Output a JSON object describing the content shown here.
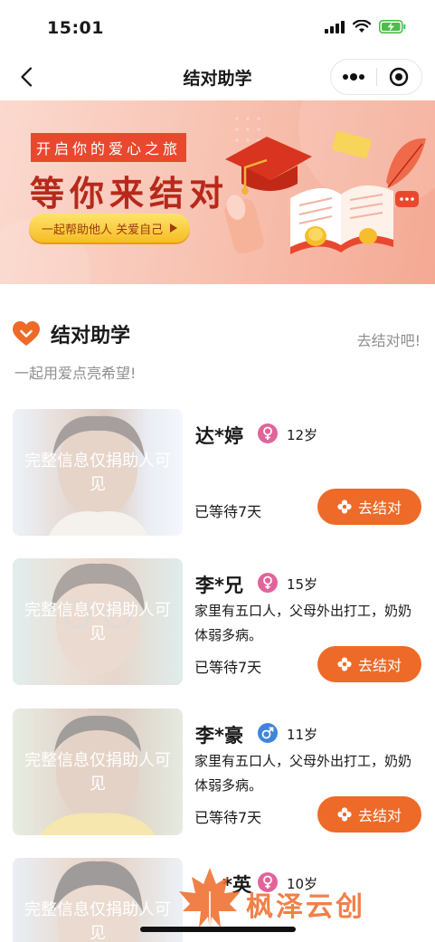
{
  "status_bar": {
    "time": "15:01"
  },
  "nav": {
    "title": "结对助学"
  },
  "banner": {
    "tag": "开启你的爱心之旅",
    "headline": "等你来结对",
    "cta": "一起帮助他人 关爱自己"
  },
  "section": {
    "title": "结对助学",
    "link": "去结对吧!",
    "subtitle": "一起用爱点亮希望!"
  },
  "mask_text": "完整信息仅捐助人可见",
  "pair_label": "去结对",
  "students": [
    {
      "name": "达*婷",
      "gender": "female",
      "age": "12岁",
      "desc": "",
      "wait": "已等待7天"
    },
    {
      "name": "李*兄",
      "gender": "female",
      "age": "15岁",
      "desc": "家里有五口人，父母外出打工，奶奶体弱多病。",
      "wait": "已等待7天"
    },
    {
      "name": "李*豪",
      "gender": "male",
      "age": "11岁",
      "desc": "家里有五口人，父母外出打工，奶奶体弱多病。",
      "wait": "已等待7天"
    },
    {
      "name": "*英",
      "gender": "female",
      "age": "10岁",
      "desc": "",
      "wait": ""
    }
  ],
  "watermark": {
    "text": "枫泽云创"
  },
  "colors": {
    "accent": "#ee6a28",
    "female": "#e0649a",
    "male": "#3f86d9",
    "banner_red": "#b7291b"
  }
}
